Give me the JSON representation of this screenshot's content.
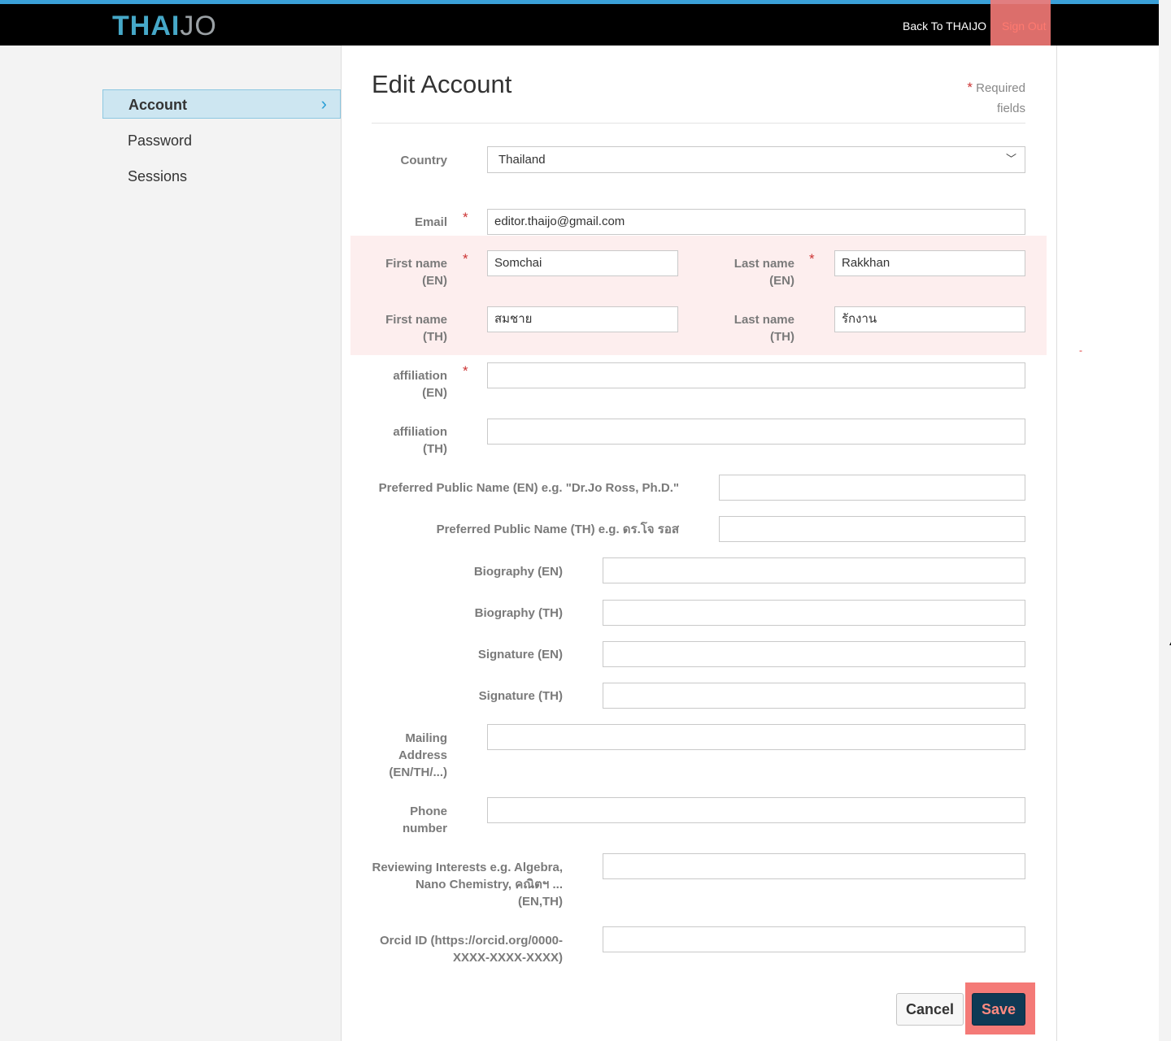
{
  "header": {
    "logo_a": "THAI",
    "logo_b": "JO",
    "back_link": "Back To THAIJO",
    "sign_out": "Sign Out"
  },
  "sidebar": {
    "items": [
      {
        "label": "Account",
        "active": true
      },
      {
        "label": "Password",
        "active": false
      },
      {
        "label": "Sessions",
        "active": false
      }
    ]
  },
  "form": {
    "title": "Edit Account",
    "required_star": "*",
    "required_note_1": "Required",
    "required_note_2": "fields",
    "country": {
      "label": "Country",
      "value": "Thailand"
    },
    "email": {
      "label": "Email",
      "value": "editor.thaijo@gmail.com"
    },
    "first_name_en": {
      "label_1": "First name",
      "label_2": "(EN)",
      "value": "Somchai"
    },
    "last_name_en": {
      "label_1": "Last name",
      "label_2": "(EN)",
      "value": "Rakkhan"
    },
    "first_name_th": {
      "label_1": "First name",
      "label_2": "(TH)",
      "value": "สมชาย"
    },
    "last_name_th": {
      "label_1": "Last name",
      "label_2": "(TH)",
      "value": "รักงาน"
    },
    "affiliation_en": {
      "label_1": "affiliation",
      "label_2": "(EN)",
      "value": ""
    },
    "affiliation_th": {
      "label_1": "affiliation",
      "label_2": "(TH)",
      "value": ""
    },
    "public_name_en": {
      "label": "Preferred Public Name (EN) e.g. \"Dr.Jo Ross, Ph.D.\"",
      "value": ""
    },
    "public_name_th": {
      "label": "Preferred Public Name (TH) e.g. ดร.โจ รอส",
      "value": ""
    },
    "biography_en": {
      "label": "Biography (EN)",
      "value": ""
    },
    "biography_th": {
      "label": "Biography (TH)",
      "value": ""
    },
    "signature_en": {
      "label": "Signature (EN)",
      "value": ""
    },
    "signature_th": {
      "label": "Signature (TH)",
      "value": ""
    },
    "mailing": {
      "label_1": "Mailing",
      "label_2": "Address",
      "label_3": "(EN/TH/...)",
      "value": ""
    },
    "phone": {
      "label_1": "Phone",
      "label_2": "number",
      "value": ""
    },
    "reviewing": {
      "label_1": "Reviewing Interests e.g. Algebra,",
      "label_2": "Nano Chemistry, คณิตฯ ...",
      "label_3": "(EN,TH)",
      "value": ""
    },
    "orcid": {
      "label_1": "Orcid ID (https://orcid.org/0000-",
      "label_2": "XXXX-XXXX-XXXX)",
      "value": ""
    }
  },
  "actions": {
    "cancel": "Cancel",
    "save": "Save"
  },
  "colors": {
    "accent": "#2a9fd6",
    "highlight": "#f47a77",
    "save_bg": "#0e3a55"
  }
}
